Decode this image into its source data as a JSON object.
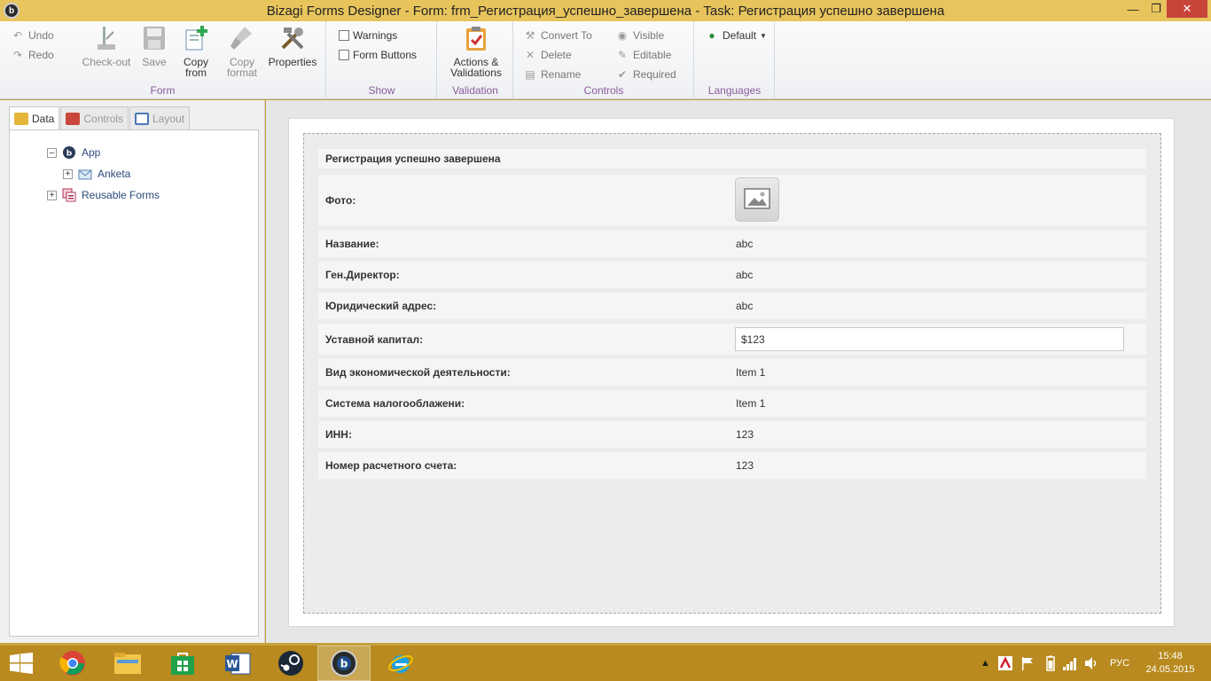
{
  "window": {
    "title": "Bizagi Forms Designer  - Form: frm_Регистрация_успешно_завершена - Task:  Регистрация успешно завершена",
    "app_icon_letter": "b"
  },
  "ribbon": {
    "form_group": {
      "label": "Form",
      "undo": "Undo",
      "redo": "Redo",
      "checkout": "Check-out",
      "save": "Save",
      "copy_from_1": "Copy",
      "copy_from_2": "from",
      "copy_format_1": "Copy",
      "copy_format_2": "format",
      "properties": "Properties"
    },
    "show_group": {
      "label": "Show",
      "warnings": "Warnings",
      "form_buttons": "Form Buttons"
    },
    "validation_group": {
      "label": "Validation",
      "actions_1": "Actions &",
      "actions_2": "Validations"
    },
    "controls_group": {
      "label": "Controls",
      "convert_to": "Convert To",
      "delete": "Delete",
      "rename": "Rename",
      "visible": "Visible",
      "editable": "Editable",
      "required": "Required"
    },
    "languages_group": {
      "label": "Languages",
      "default": "Default"
    }
  },
  "left_panel": {
    "tabs": [
      {
        "label": "Data",
        "active": true
      },
      {
        "label": "Controls",
        "active": false
      },
      {
        "label": "Layout",
        "active": false
      }
    ],
    "tree": {
      "app": "App",
      "anketa": "Anketa",
      "reusable_forms": "Reusable Forms"
    }
  },
  "form": {
    "title": "Регистрация успешно завершена",
    "rows": [
      {
        "label": "Фото:",
        "value": ""
      },
      {
        "label": "Название:",
        "value": "abc"
      },
      {
        "label": "Ген.Директор:",
        "value": "abc"
      },
      {
        "label": "Юридический адрес:",
        "value": "abc"
      },
      {
        "label": "Уставной капитал:",
        "value": "$123"
      },
      {
        "label": "Вид экономической деятельности:",
        "value": "Item 1"
      },
      {
        "label": "Система налогооблажени:",
        "value": "Item 1"
      },
      {
        "label": "ИНН:",
        "value": "123"
      },
      {
        "label": "Номер расчетного счета:",
        "value": "123"
      }
    ]
  },
  "taskbar": {
    "language": "РУС",
    "time": "15:48",
    "date": "24.05.2015"
  },
  "colors": {
    "title_bar": "#e8c45d",
    "taskbar": "#b98a1f",
    "group_label": "#8a5a9c"
  }
}
